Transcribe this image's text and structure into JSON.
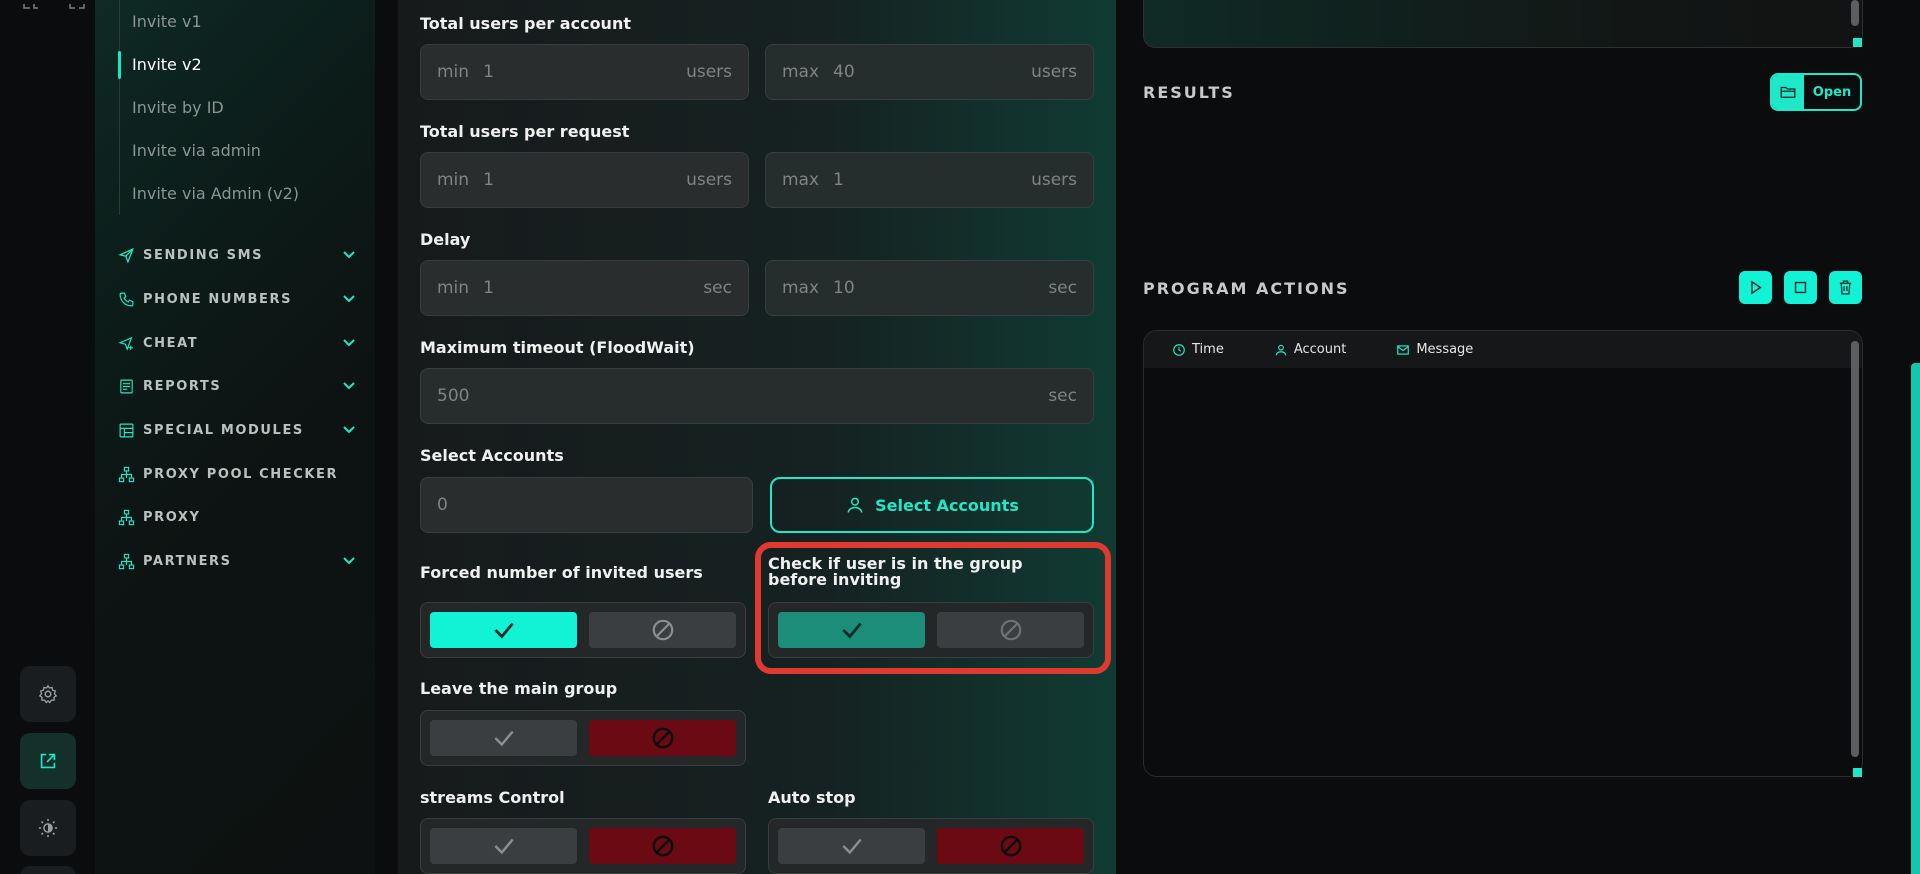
{
  "sidebar": {
    "sub_items": [
      {
        "label": "Invite v1",
        "active": false
      },
      {
        "label": "Invite v2",
        "active": true
      },
      {
        "label": "Invite by ID",
        "active": false
      },
      {
        "label": "Invite via admin",
        "active": false
      },
      {
        "label": "Invite via Admin (v2)",
        "active": false
      }
    ],
    "nav": [
      {
        "label": "SENDING SMS",
        "icon": "send-icon",
        "expandable": true
      },
      {
        "label": "PHONE NUMBERS",
        "icon": "phone-icon",
        "expandable": true
      },
      {
        "label": "CHEAT",
        "icon": "send-plus-icon",
        "expandable": true
      },
      {
        "label": "REPORTS",
        "icon": "report-icon",
        "expandable": true
      },
      {
        "label": "SPECIAL MODULES",
        "icon": "grid-icon",
        "expandable": true
      },
      {
        "label": "PROXY POOL CHECKER",
        "icon": "network-icon",
        "expandable": false
      },
      {
        "label": "PROXY",
        "icon": "network-icon",
        "expandable": false
      },
      {
        "label": "PARTNERS",
        "icon": "network-icon",
        "expandable": true
      }
    ]
  },
  "form": {
    "users_per_account": {
      "label": "Total users per account",
      "min": {
        "prefix": "min",
        "value": "1",
        "unit": "users"
      },
      "max": {
        "prefix": "max",
        "value": "40",
        "unit": "users"
      }
    },
    "users_per_request": {
      "label": "Total users per request",
      "min": {
        "prefix": "min",
        "value": "1",
        "unit": "users"
      },
      "max": {
        "prefix": "max",
        "value": "1",
        "unit": "users"
      }
    },
    "delay": {
      "label": "Delay",
      "min": {
        "prefix": "min",
        "value": "1",
        "unit": "sec"
      },
      "max": {
        "prefix": "max",
        "value": "10",
        "unit": "sec"
      }
    },
    "timeout": {
      "label": "Maximum timeout (FloodWait)",
      "value": "500",
      "unit": "sec"
    },
    "accounts": {
      "label": "Select Accounts",
      "value": "0",
      "button": "Select Accounts"
    },
    "forced_number": {
      "label": "Forced number of invited users",
      "state": "on"
    },
    "check_in_group": {
      "label": "Check if user is in the group before inviting",
      "state": "on"
    },
    "leave_main_group": {
      "label": "Leave the main group",
      "state": "off"
    },
    "streams_control": {
      "label": "streams Control",
      "state": "off"
    },
    "auto_stop": {
      "label": "Auto stop",
      "state": "off"
    }
  },
  "results": {
    "title": "RESULTS",
    "open_label": "Open"
  },
  "program_actions": {
    "title": "PROGRAM ACTIONS",
    "columns": [
      "Time",
      "Account",
      "Message"
    ]
  },
  "colors": {
    "accent": "#12f2d5",
    "off_red": "#6b0a12",
    "highlight": "#e03a30"
  }
}
